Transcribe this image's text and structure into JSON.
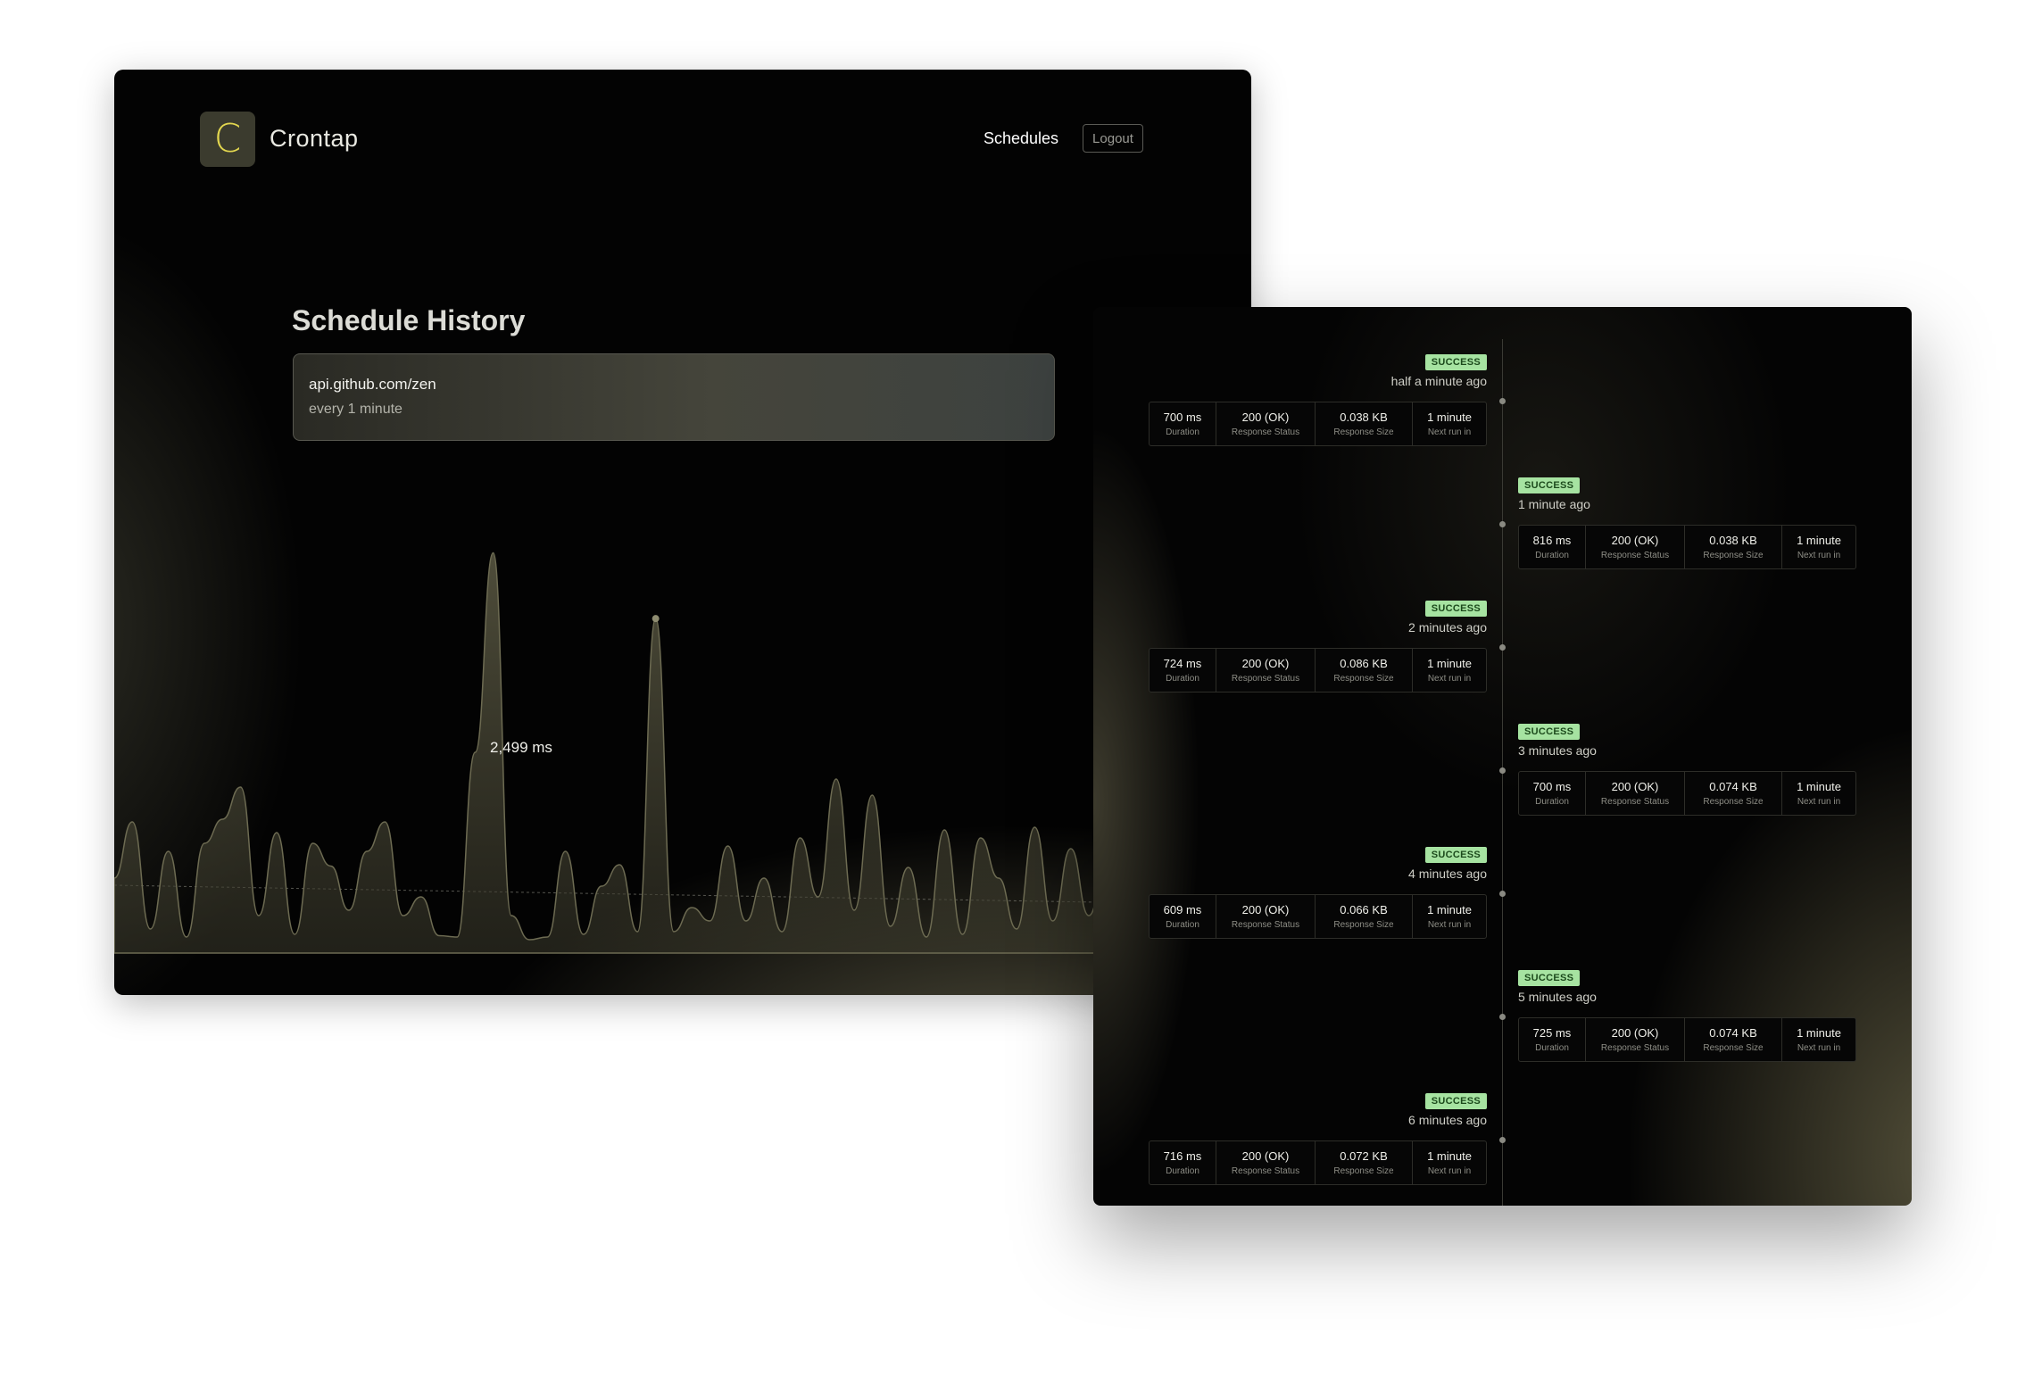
{
  "app": {
    "logo_letter": "C",
    "brand": "Crontap",
    "nav": {
      "schedules": "Schedules",
      "logout": "Logout"
    }
  },
  "page": {
    "title": "Schedule History",
    "schedule": {
      "url": "api.github.com/zen",
      "frequency": "every 1 minute"
    }
  },
  "chart_data": {
    "type": "area",
    "highlight_label": "2,499 ms",
    "values": [
      560,
      980,
      180,
      760,
      120,
      820,
      1000,
      1240,
      280,
      900,
      140,
      820,
      650,
      320,
      760,
      980,
      280,
      420,
      130,
      120,
      1500,
      2990,
      280,
      100,
      120,
      760,
      140,
      500,
      660,
      160,
      2499,
      160,
      340,
      240,
      800,
      240,
      560,
      160,
      860,
      420,
      1300,
      320,
      1180,
      200,
      640,
      120,
      920,
      140,
      860,
      560,
      180,
      940,
      240,
      780,
      280,
      720,
      200,
      720,
      520,
      320,
      560,
      500,
      700,
      1500
    ]
  },
  "timeline": [
    {
      "status": "SUCCESS",
      "ago": "half a minute ago",
      "stats": [
        {
          "value": "700 ms",
          "key": "Duration"
        },
        {
          "value": "200 (OK)",
          "key": "Response Status"
        },
        {
          "value": "0.038 KB",
          "key": "Response Size"
        },
        {
          "value": "1 minute",
          "key": "Next run in"
        }
      ]
    },
    {
      "status": "SUCCESS",
      "ago": "1 minute ago",
      "stats": [
        {
          "value": "816 ms",
          "key": "Duration"
        },
        {
          "value": "200 (OK)",
          "key": "Response Status"
        },
        {
          "value": "0.038 KB",
          "key": "Response Size"
        },
        {
          "value": "1 minute",
          "key": "Next run in"
        }
      ]
    },
    {
      "status": "SUCCESS",
      "ago": "2 minutes ago",
      "stats": [
        {
          "value": "724 ms",
          "key": "Duration"
        },
        {
          "value": "200 (OK)",
          "key": "Response Status"
        },
        {
          "value": "0.086 KB",
          "key": "Response Size"
        },
        {
          "value": "1 minute",
          "key": "Next run in"
        }
      ]
    },
    {
      "status": "SUCCESS",
      "ago": "3 minutes ago",
      "stats": [
        {
          "value": "700 ms",
          "key": "Duration"
        },
        {
          "value": "200 (OK)",
          "key": "Response Status"
        },
        {
          "value": "0.074 KB",
          "key": "Response Size"
        },
        {
          "value": "1 minute",
          "key": "Next run in"
        }
      ]
    },
    {
      "status": "SUCCESS",
      "ago": "4 minutes ago",
      "stats": [
        {
          "value": "609 ms",
          "key": "Duration"
        },
        {
          "value": "200 (OK)",
          "key": "Response Status"
        },
        {
          "value": "0.066 KB",
          "key": "Response Size"
        },
        {
          "value": "1 minute",
          "key": "Next run in"
        }
      ]
    },
    {
      "status": "SUCCESS",
      "ago": "5 minutes ago",
      "stats": [
        {
          "value": "725 ms",
          "key": "Duration"
        },
        {
          "value": "200 (OK)",
          "key": "Response Status"
        },
        {
          "value": "0.074 KB",
          "key": "Response Size"
        },
        {
          "value": "1 minute",
          "key": "Next run in"
        }
      ]
    },
    {
      "status": "SUCCESS",
      "ago": "6 minutes ago",
      "stats": [
        {
          "value": "716 ms",
          "key": "Duration"
        },
        {
          "value": "200 (OK)",
          "key": "Response Status"
        },
        {
          "value": "0.072 KB",
          "key": "Response Size"
        },
        {
          "value": "1 minute",
          "key": "Next run in"
        }
      ]
    }
  ]
}
